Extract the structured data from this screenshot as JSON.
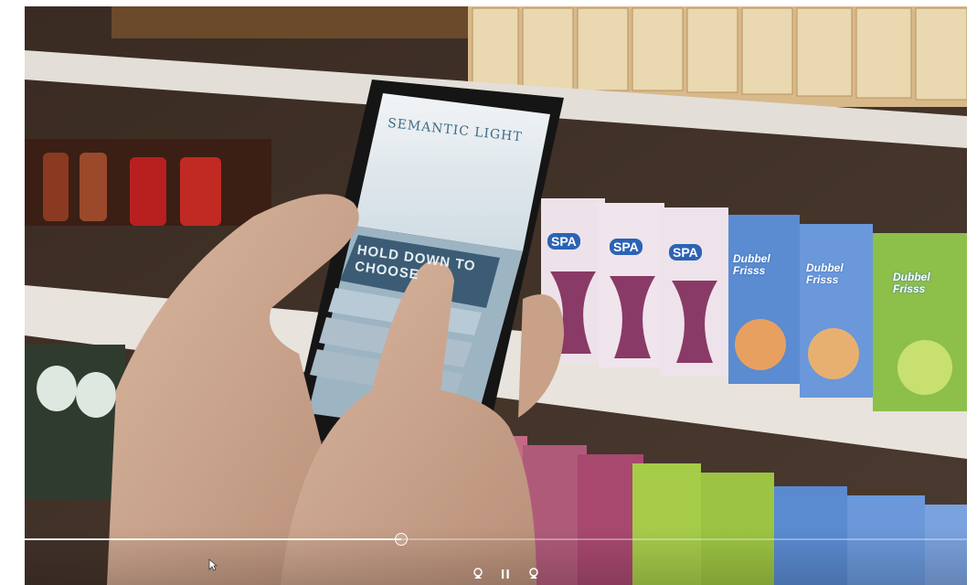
{
  "video": {
    "progress": 0.4,
    "phone_app_title": "SEMANTIC LIGHT",
    "phone_banner_text": "HOLD DOWN TO CHOOSE",
    "product_brands": [
      "SPA",
      "SPA",
      "SPA",
      "Dubbel Frisss",
      "Dubbel Frisss",
      "Dubbel Frisss"
    ]
  },
  "player": {
    "controls": [
      {
        "name": "previous-button",
        "icon": "previous-icon"
      },
      {
        "name": "pause-button",
        "icon": "pause-icon"
      },
      {
        "name": "next-button",
        "icon": "next-icon"
      }
    ]
  },
  "colors": {
    "shelf": "#e3ded8",
    "phone_screen": "#e9eef1",
    "phone_accent": "#3f6b86",
    "control_fg": "#ffffff"
  }
}
